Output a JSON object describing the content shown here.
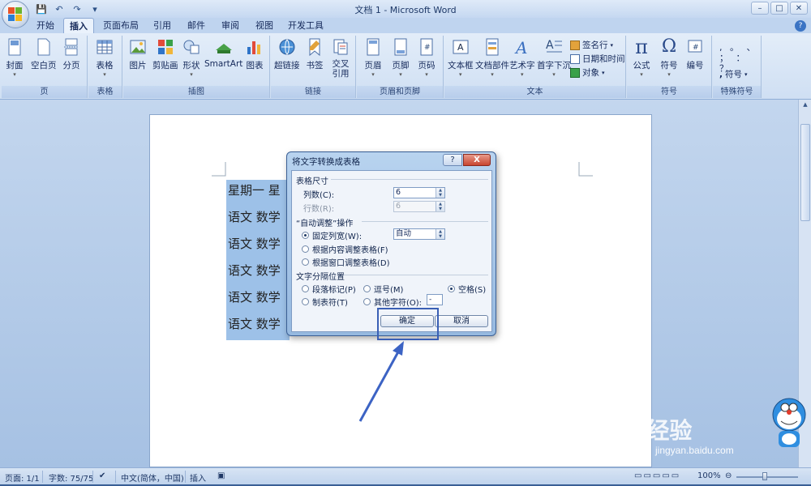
{
  "window": {
    "title": "文档 1 - Microsoft Word",
    "min": "–",
    "max": "□",
    "close": "✕"
  },
  "qat": {
    "save": "💾",
    "undo": "↶",
    "redo": "↷",
    "more": "▾"
  },
  "tabs": [
    {
      "label": "开始",
      "active": false
    },
    {
      "label": "插入",
      "active": true
    },
    {
      "label": "页面布局",
      "active": false
    },
    {
      "label": "引用",
      "active": false
    },
    {
      "label": "邮件",
      "active": false
    },
    {
      "label": "审阅",
      "active": false
    },
    {
      "label": "视图",
      "active": false
    },
    {
      "label": "开发工具",
      "active": false
    }
  ],
  "help": "?",
  "ribbon": {
    "groups": {
      "page": {
        "label": "页",
        "buttons": [
          "封面",
          "空白页",
          "分页"
        ]
      },
      "table": {
        "label": "表格",
        "buttons": [
          "表格"
        ]
      },
      "illustrations": {
        "label": "插图",
        "buttons": [
          "图片",
          "剪贴画",
          "形状",
          "SmartArt",
          "图表"
        ]
      },
      "links": {
        "label": "链接",
        "buttons": [
          "超链接",
          "书签",
          "交叉引用"
        ]
      },
      "header_footer": {
        "label": "页眉和页脚",
        "buttons": [
          "页眉",
          "页脚",
          "页码"
        ]
      },
      "text": {
        "label": "文本",
        "buttons": [
          "文本框",
          "文档部件",
          "艺术字",
          "首字下沉"
        ],
        "small": [
          "签名行",
          "日期和时间",
          "对象"
        ]
      },
      "symbols": {
        "label": "符号",
        "buttons": [
          "公式",
          "符号",
          "编号"
        ]
      },
      "special": {
        "label": "特殊符号",
        "chars": ", 。 、 ； ： ？",
        "button": "符号"
      }
    }
  },
  "document": {
    "lines": [
      "星期一  星",
      "语文  数学",
      "语文  数学",
      "语文  数学",
      "语文  数学",
      "语文  数学"
    ]
  },
  "dialog": {
    "title": "将文字转换成表格",
    "help": "?",
    "close": "X",
    "size_section": "表格尺寸",
    "cols_label": "列数(C):",
    "cols_value": "6",
    "rows_label": "行数(R):",
    "rows_value": "6",
    "autofit_section": "“自动调整”操作",
    "fixed_width": "固定列宽(W):",
    "fixed_width_value": "自动",
    "autofit_contents": "根据内容调整表格(F)",
    "autofit_window": "根据窗口调整表格(D)",
    "separator_section": "文字分隔位置",
    "sep_paragraph": "段落标记(P)",
    "sep_comma": "逗号(M)",
    "sep_space": "空格(S)",
    "sep_tab": "制表符(T)",
    "sep_other": "其他字符(O):",
    "sep_other_value": "-",
    "ok": "确定",
    "cancel": "取消"
  },
  "status": {
    "page": "页面: 1/1",
    "words": "字数: 75/75",
    "lang": "中文(简体，中国)",
    "mode": "插入",
    "zoom": "100%"
  },
  "watermark": {
    "brand": "Bai 经验",
    "url": "jingyan.baidu.com"
  }
}
